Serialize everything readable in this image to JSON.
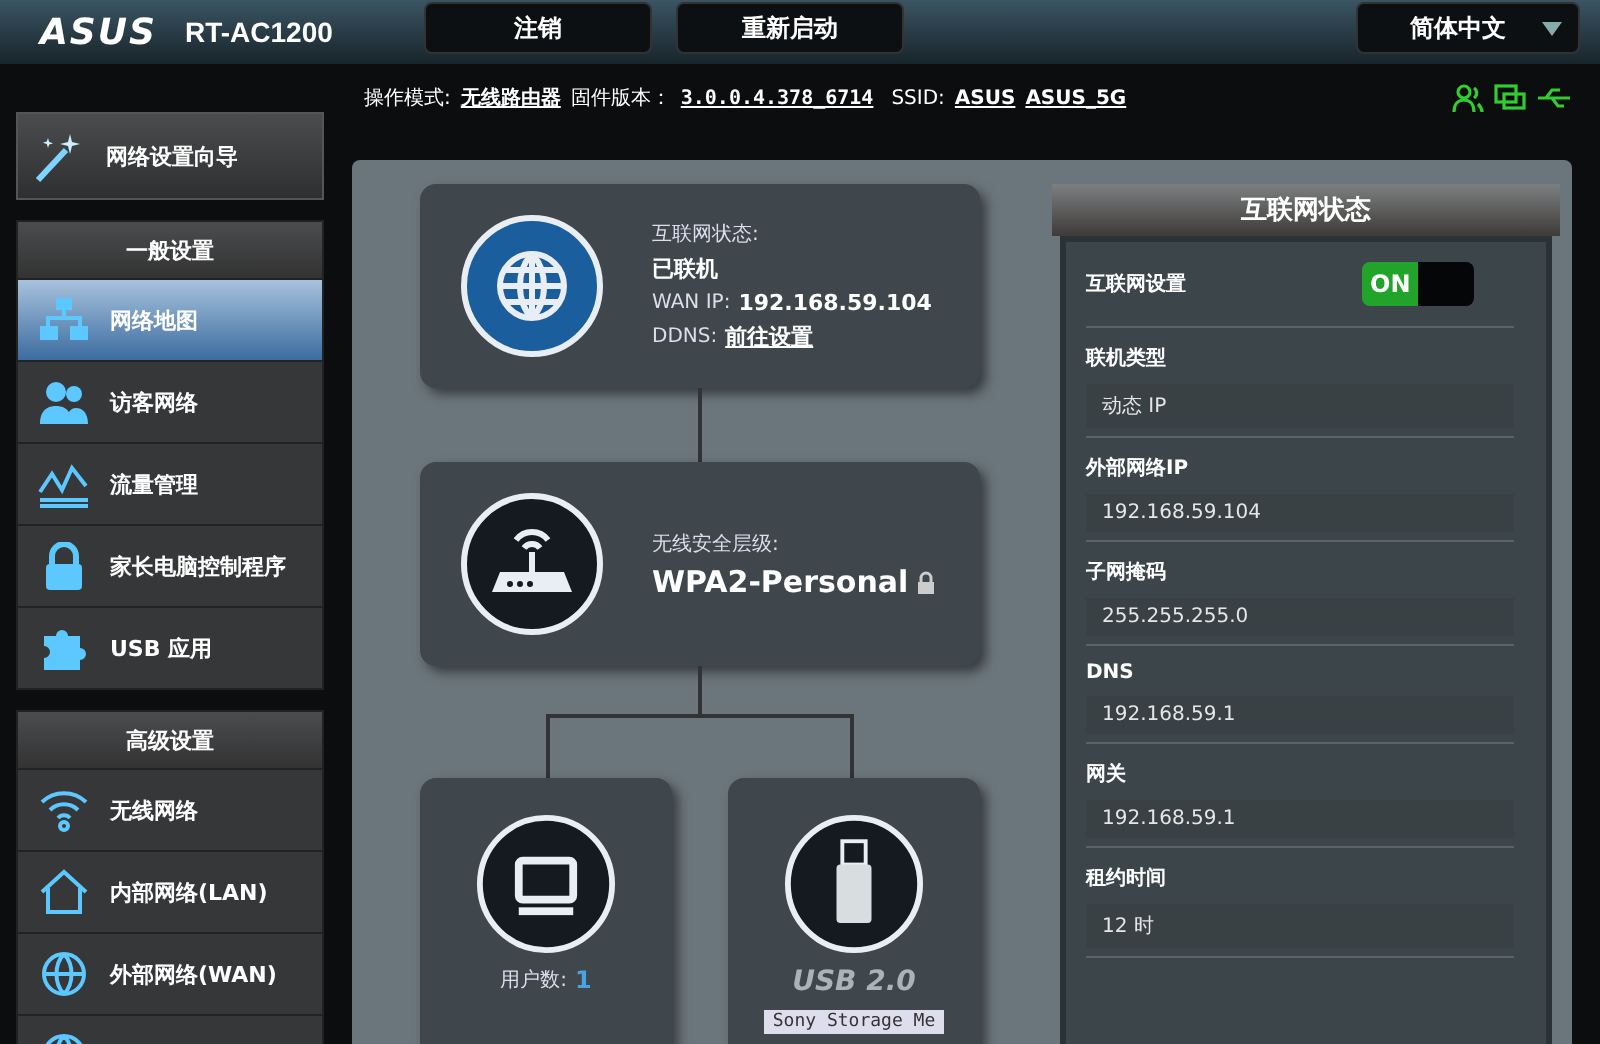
{
  "header": {
    "logo": "ASUS",
    "model": "RT-AC1200",
    "buttons": [
      "注销",
      "重新启动"
    ],
    "language": "简体中文"
  },
  "info_bar": {
    "mode_label": "操作模式:",
    "mode": "无线路由器",
    "firmware_label": "固件版本：",
    "firmware": "3.0.0.4.378_6714",
    "ssid_label": "SSID:",
    "ssids": [
      "ASUS",
      "ASUS_5G"
    ]
  },
  "sidebar": {
    "wizard": "网络设置向导",
    "sections": [
      {
        "title": "一般设置",
        "items": [
          {
            "label": "网络地图",
            "kind": "map",
            "selected": true
          },
          {
            "label": "访客网络",
            "kind": "guests",
            "selected": false
          },
          {
            "label": "流量管理",
            "kind": "traffic",
            "selected": false
          },
          {
            "label": "家长电脑控制程序",
            "kind": "lock",
            "selected": false
          },
          {
            "label": "USB 应用",
            "kind": "puzzle",
            "selected": false
          }
        ]
      },
      {
        "title": "高级设置",
        "items": [
          {
            "label": "无线网络",
            "kind": "wifi",
            "selected": false
          },
          {
            "label": "内部网络(LAN)",
            "kind": "home",
            "selected": false
          },
          {
            "label": "外部网络(WAN)",
            "kind": "globe",
            "selected": false
          },
          {
            "kind": "globe",
            "selected": false
          }
        ]
      }
    ]
  },
  "network_map": {
    "internet": {
      "status_label": "互联网状态:",
      "status": "已联机",
      "wan_ip_label": "WAN IP:",
      "wan_ip": "192.168.59.104",
      "ddns_label": "DDNS:",
      "ddns_link": "前往设置"
    },
    "router": {
      "security_label": "无线安全层级:",
      "security": "WPA2-Personal"
    },
    "clients": {
      "label": "用户数:",
      "count": "1"
    },
    "usb": {
      "label": "USB 2.0",
      "device": "Sony Storage Me"
    }
  },
  "status_panel": {
    "title": "互联网状态",
    "switch": {
      "label": "互联网设置",
      "text": "ON",
      "on": true
    },
    "fields": [
      {
        "label": "联机类型",
        "value": "动态 IP"
      },
      {
        "label": "外部网络IP",
        "value": "192.168.59.104"
      },
      {
        "label": "子网掩码",
        "value": "255.255.255.0"
      },
      {
        "label": "DNS",
        "value": "192.168.59.1"
      },
      {
        "label": "网关",
        "value": "192.168.59.1"
      },
      {
        "label": "租约时间",
        "value": "12 时"
      }
    ]
  }
}
